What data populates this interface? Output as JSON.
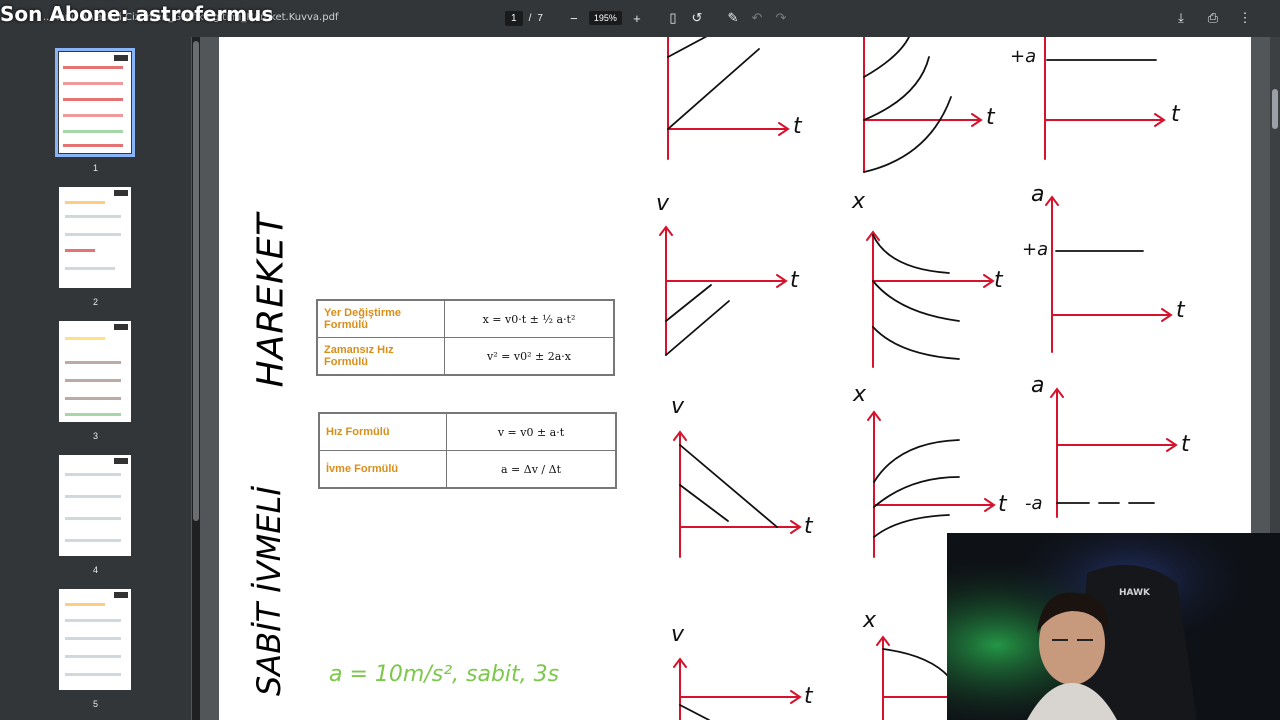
{
  "overlay": {
    "text": "Son Abone: astrofermus"
  },
  "toolbar": {
    "filename": "...Konu Anlatimi Cizimleri_Grafik Egitimi_Hareket.Kuvva.pdf",
    "page_current": "1",
    "page_sep": "/",
    "page_total": "7",
    "zoom": "195%",
    "icons": [
      "menu-icon",
      "zoom-out-icon",
      "zoom-in-icon",
      "fit-page-icon",
      "rotate-icon",
      "annotate-icon",
      "undo-icon",
      "redo-icon",
      "download-icon",
      "print-icon",
      "more-icon"
    ]
  },
  "sidebar": {
    "thumbnails": [
      {
        "num": "1",
        "selected": true
      },
      {
        "num": "2",
        "selected": false
      },
      {
        "num": "3",
        "selected": false
      },
      {
        "num": "4",
        "selected": false
      },
      {
        "num": "5",
        "selected": false
      }
    ]
  },
  "document": {
    "handwritten_title_1": "HAREKET",
    "handwritten_title_2": "SABİT İVMELİ",
    "note": "a = 10m/s², sabit, 3s",
    "table1": [
      {
        "label": "Yer Değiştirme Formülü",
        "formula": "x = v0·t ± ½ a·t²"
      },
      {
        "label": "Zamansız Hız Formülü",
        "formula": "v² = v0² ± 2a·x"
      }
    ],
    "table2": [
      {
        "label": "Hız Formülü",
        "formula": "v = v0 ± a·t"
      },
      {
        "label": "İvme Formülü",
        "formula": "a = Δv / Δt"
      }
    ],
    "graph_labels": {
      "t": "t",
      "v": "v",
      "x": "x",
      "a": "a",
      "plus_a": "+a",
      "minus_a": "-a"
    }
  },
  "colors": {
    "graph_axis": "#d6122c",
    "handwriting": "#111111",
    "note": "#7cc84a",
    "formula_label": "#d98e1a"
  }
}
